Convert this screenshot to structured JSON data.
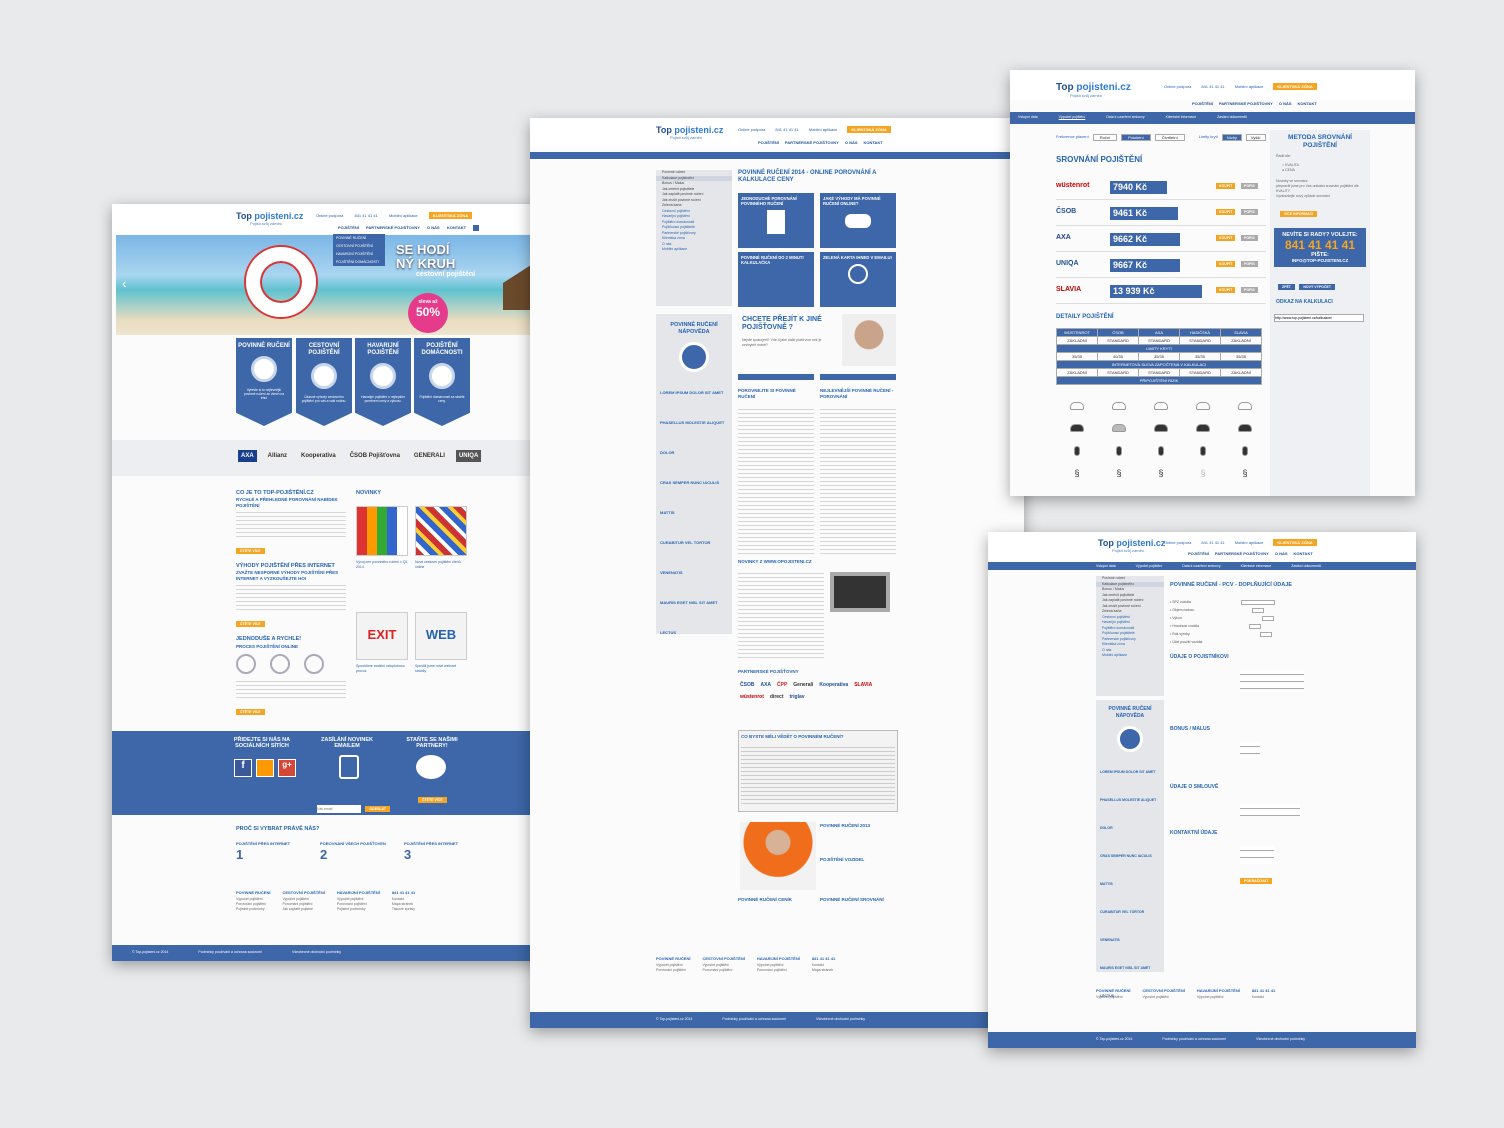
{
  "brand": {
    "name": "Top pojisteni.cz",
    "name_a": "Top",
    "name_b": "pojisteni.cz",
    "tagline": "Pojisti svůj zaměo"
  },
  "header": {
    "support": "Online podpora",
    "phone": "841 41 41 41",
    "mobile": "Mobilní aplikace",
    "client": "KLIENTSKÁ ZÓNA",
    "nav": [
      "POJIŠTĚNÍ",
      "PARTNERSKÉ POJIŠŤOVNY",
      "O NÁS",
      "KONTAKT"
    ]
  },
  "home": {
    "dropdown": [
      "POVINNÉ RUČENÍ",
      "CESTOVNÍ POJIŠTĚNÍ",
      "HAVARIJNÍ POJIŠTĚNÍ",
      "POJIŠTĚNÍ DOMÁCNOSTI"
    ],
    "hero_line1": "SE HODÍ",
    "hero_line2": "NÝ KRUH",
    "hero_sub": "cestovní pojištění",
    "badge_top": "sleva až",
    "badge_val": "50%",
    "shields": [
      {
        "title": "POVINNÉ RUČENÍ",
        "text": "Vyřešte si to nejlevnější povinné ručení ze všech na trhu!"
      },
      {
        "title": "CESTOVNÍ POJIŠTĚNÍ",
        "text": "Úžasné výhody cestovního pojištění pro vás a vaši rodinu."
      },
      {
        "title": "HAVARIJNÍ POJIŠTĚNÍ",
        "text": "Havarijní pojištění s nejlepším poměrem ceny a výkonu."
      },
      {
        "title": "POJIŠTĚNÍ DOMÁCNOSTI",
        "text": "Pojištění domácnosti za skvělé ceny."
      }
    ],
    "partners": [
      "AXA",
      "Allianz",
      "Kooperativa",
      "ČSOB Pojišťovna",
      "GENERALI",
      "UNIQA"
    ],
    "what_title": "CO JE TO TOP-POJIŠTĚNÍ.CZ",
    "what_sub": "RYCHLÉ A PŘEHLEDNÉ POROVNÁNÍ NABÍDEK POJIŠTĚNÍ",
    "advantages_title": "VÝHODY POJIŠTĚNÍ PŘES INTERNET",
    "advantages_sub": "ZVAŽTE NESPORNÉ VÝHODY POJIŠTĚNÍ PŘES INTERNET A VYZKOUŠEJTE HO!",
    "simple_title": "JEDNODUŠE A RYCHLE!",
    "simple_sub": "PROCES POJIŠTĚNÍ ONLINE",
    "more": "ČTĚTE VÍCE",
    "news_title": "NOVINKY",
    "news": [
      "Vývoj cen povinného ručení v Q1 2014",
      "Nové cestovní pojištění členů online",
      "Spouštíme mobilní celoplošnou provoz",
      "Spustili jsme nové webové stránky"
    ],
    "social": [
      {
        "title": "PŘIDEJTE SI NÁS NA SOCIÁLNÍCH SÍTÍCH"
      },
      {
        "title": "ZASÍLÁNÍ NOVINEK EMAILEM"
      },
      {
        "title": "STAŇTE SE NAŠIMI PARTNERY!"
      }
    ],
    "email_placeholder": "Váš email",
    "send": "ODESLAT",
    "why_title": "PROČ SI VYBRAT PRÁVĚ NÁS?",
    "why": [
      "POJIŠTĚNÍ PŘES INTERNET",
      "POROVNÁNÍ VŠECH POJIŠŤOVEN",
      "POJIŠTĚNÍ PŘES INTERNET"
    ]
  },
  "footer": {
    "cols": [
      {
        "title": "POVINNÉ RUČENÍ",
        "items": [
          "Výpočet pojištění",
          "Porovnání pojištění",
          "Pojistné podmínky"
        ]
      },
      {
        "title": "CESTOVNÍ POJIŠTĚNÍ",
        "items": [
          "Výpočet pojištění",
          "Porovnání pojištění",
          "Jak zaplatit pojistné"
        ]
      },
      {
        "title": "HAVARIJNÍ POJIŠTĚNÍ",
        "items": [
          "Výpočet pojištění",
          "Porovnání pojištění",
          "Pojistné podmínky"
        ]
      },
      {
        "title": "841 41 41 41",
        "items": [
          "Kontakt",
          "Mapa stránek",
          "Tiskové zprávy"
        ]
      }
    ],
    "copy": "© Top-pojisteni.cz 2014",
    "terms": "Podmínky používání a ochrana soukromí",
    "gtc": "Všeobecné obchodní podmínky"
  },
  "article": {
    "title": "POVINNÉ RUČENÍ 2014 - ONLINE POROVNÁNÍ A KALKULACE CENY",
    "sidebar": [
      "Povinné ručení",
      "Kalkulace pojistného",
      "Bonus / Malus",
      "Jak změnit pojistitele",
      "Jak zaplatit povinné ručení",
      "Jak zrušit povinné ručení",
      "Zelená karta",
      "Cestovní pojištění",
      "Havarijní pojištění",
      "Pojištění domácnosti",
      "Pojišťovací pojistitele",
      "Partnerské pojišťovny",
      "Klientská zóna",
      "O nás",
      "Mobilní aplikace"
    ],
    "help_title": "POVINNÉ RUČENÍ NÁPOVĚDA",
    "help": [
      "LOREM IPSUM DOLOR SIT AMET",
      "PHASELLUS MOLESTIE ALIQUET DOLOR",
      "CRAS SEMPER NUNC IACULIS MATTIS",
      "CURABITUR VEL TORTOR VENENATIS",
      "MAURIS EGET NISL SIT AMET LECTUS"
    ],
    "boxes": [
      "JEDNODUCHÉ POROVNÁNÍ POVINNÉHO RUČENÍ",
      "JAKÉ VÝHODY MÁ POVINNÉ RUČENÍ ONLINE?",
      "POVINNÉ RUČENÍ DO 2 MINUT! KALKULAČKA",
      "ZELENÁ KARTA IHNED V EMAILU!"
    ],
    "switch_title": "CHCETE PŘEJÍT K JINÉ POJIŠŤOVNĚ ?",
    "switch_text": "Nejste spokojeni? Víte-li jaké další platit více než je nezbytně nutné?",
    "compare_title": "POROVNEJTE SI POVINNÉ RUČENÍ",
    "cheap_title": "NEJLEVNĚJŠÍ POVINNÉ RUČENÍ - POROVNÁNÍ",
    "news_title": "NOVINKY Z WWW.OPOJISTENI.CZ",
    "partners_title": "PARTNERSKÉ POJIŠŤOVNY",
    "partners": [
      "ČSOB",
      "AXA",
      "ČPP",
      "Generali",
      "Kooperativa",
      "SLAVIA",
      "wüstenrot",
      "direct",
      "triglav"
    ],
    "know_title": "CO BYSTE MĚLI VĚDĚT O POVINNÉM RUČENÍ?",
    "bottom": [
      "POVINNÉ RUČENÍ 2013",
      "POJIŠTĚNÍ VOZIDEL",
      "POVINNÉ RUČENÍ CENÍK",
      "POVINNÉ RUČENÍ SROVNÁNÍ"
    ]
  },
  "compare": {
    "crumbs": [
      "Vstupní data",
      "Výpočet pojištění",
      "Data k uzavření smlouvy",
      "Klientské informace",
      "Zaslání dokumentů"
    ],
    "freq_label": "Frekvence placení",
    "freq": [
      "Roční",
      "Pololetní",
      "Čtvrtletní"
    ],
    "limits_label": "Limity krytí",
    "limits": [
      "Nízký",
      "Vyšší"
    ],
    "title": "SROVNÁNÍ POJIŠTĚNÍ",
    "offers": [
      {
        "insurer": "wüstenrot",
        "price": "7940 Kč",
        "fill": 0.62
      },
      {
        "insurer": "ČSOB",
        "price": "9461 Kč",
        "fill": 0.74
      },
      {
        "insurer": "AXA",
        "price": "9662 Kč",
        "fill": 0.76
      },
      {
        "insurer": "UNIQA",
        "price": "9667 Kč",
        "fill": 0.76
      },
      {
        "insurer": "SLAVIA",
        "price": "13 939 Kč",
        "fill": 1.0
      }
    ],
    "buy": "KOUPIT",
    "info": "POPIS",
    "method_title": "METODA SROVNÁNÍ POJIŠTĚNÍ",
    "sort_label": "Řadit dle:",
    "sort": [
      "KVALITA",
      "CENA"
    ],
    "news_label": "Novinky ve srovnání",
    "news": [
      "přepravili jsme pro Vás unikátní srovnání pojištění dle KVALITY",
      "Vyzkoušejte nový způsob srovnání"
    ],
    "more_info": "VÍCE INFORMACÍ",
    "help_title": "NEVÍTE SI RADY? VOLEJTE:",
    "help_phone": "841 41 41 41",
    "write": "PIŠTE:",
    "email": "INFO@TOP-POJISTENI.CZ",
    "back": "ZPĚT",
    "new": "NOVÝ VÝPOČET",
    "link_title": "ODKAZ NA KALKULACI",
    "link": "http://www.top-pojisteni.cz/kalkulace/",
    "details_title": "DETAILY POJIŠTĚNÍ",
    "cols": [
      "WÜSTENROT",
      "ČSOB",
      "AXA",
      "HASIČSKÁ",
      "SLAVIA"
    ],
    "row1": [
      "ZÁKLADNÍ",
      "STANDARD",
      "STANDARD",
      "STANDARD",
      "ZÁKLADNÍ"
    ],
    "limits_row": "LIMITY KRYTÍ",
    "limits_vals": [
      "35/35",
      "40/35",
      "35/35",
      "35/35",
      "35/35"
    ],
    "discount_row": "INTERNETOVÁ SLEVA ZAPOČTENÁ V KALKULACI",
    "extra_row": "PŘIPOJIŠTĚNÍ RIZIK"
  },
  "form": {
    "title": "POVINNÉ RUČENÍ - PCV - DOPLŇUJÍCÍ ÚDAJE",
    "sections": [
      "ÚDAJE O POJISTNÍKOVI",
      "BONUS / MALUS",
      "ÚDAJE O SMLOUVĚ",
      "KONTAKTNÍ ÚDAJE"
    ],
    "fields": [
      "SPZ vozidla",
      "Objem motoru",
      "Výkon",
      "Hmotnost vozidla",
      "Rok výroby",
      "Účel použití vozidla"
    ],
    "submit": "POKRAČOVAT"
  }
}
